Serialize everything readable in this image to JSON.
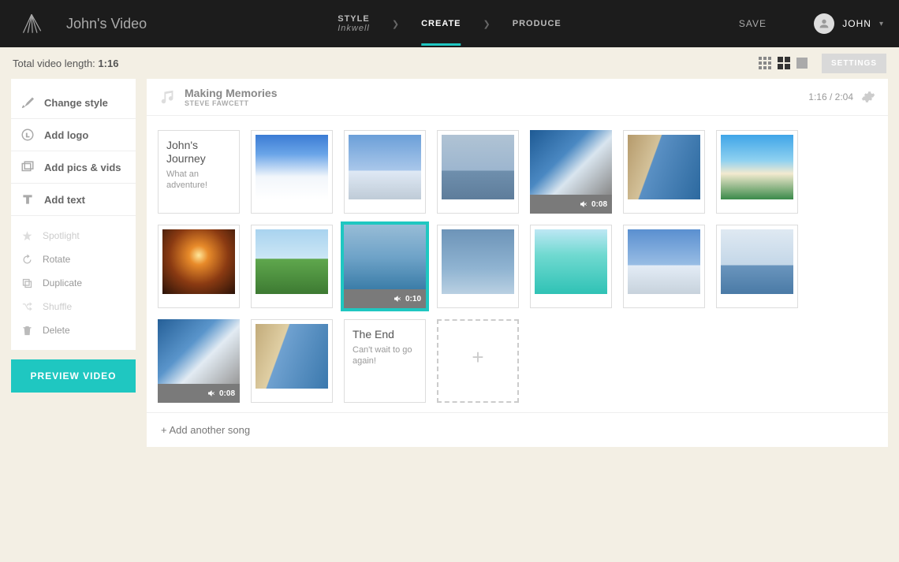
{
  "header": {
    "video_title": "John's Video",
    "save_label": "SAVE",
    "user_name": "JOHN"
  },
  "steps": {
    "style": {
      "label": "STYLE",
      "sub": "Inkwell"
    },
    "create": {
      "label": "CREATE"
    },
    "produce": {
      "label": "PRODUCE"
    }
  },
  "subheader": {
    "total_label": "Total video length: ",
    "total_value": "1:16",
    "settings_label": "SETTINGS"
  },
  "sidebar": {
    "change_style": "Change style",
    "add_logo": "Add logo",
    "add_pics": "Add pics & vids",
    "add_text": "Add text",
    "spotlight": "Spotlight",
    "rotate": "Rotate",
    "duplicate": "Duplicate",
    "shuffle": "Shuffle",
    "delete": "Delete",
    "preview_label": "PREVIEW VIDEO"
  },
  "song": {
    "title": "Making Memories",
    "artist": "STEVE FAWCETT",
    "duration_used": "1:16",
    "duration_total": "2:04",
    "duration_display": "1:16 / 2:04"
  },
  "clips": {
    "intro_title": "John's Journey",
    "intro_sub": "What an adventure!",
    "outro_title": "The End",
    "outro_sub": "Can't wait to go again!",
    "video1_time": "0:08",
    "video2_time": "0:10",
    "video3_time": "0:08"
  },
  "footer": {
    "add_song": "+ Add another song"
  }
}
